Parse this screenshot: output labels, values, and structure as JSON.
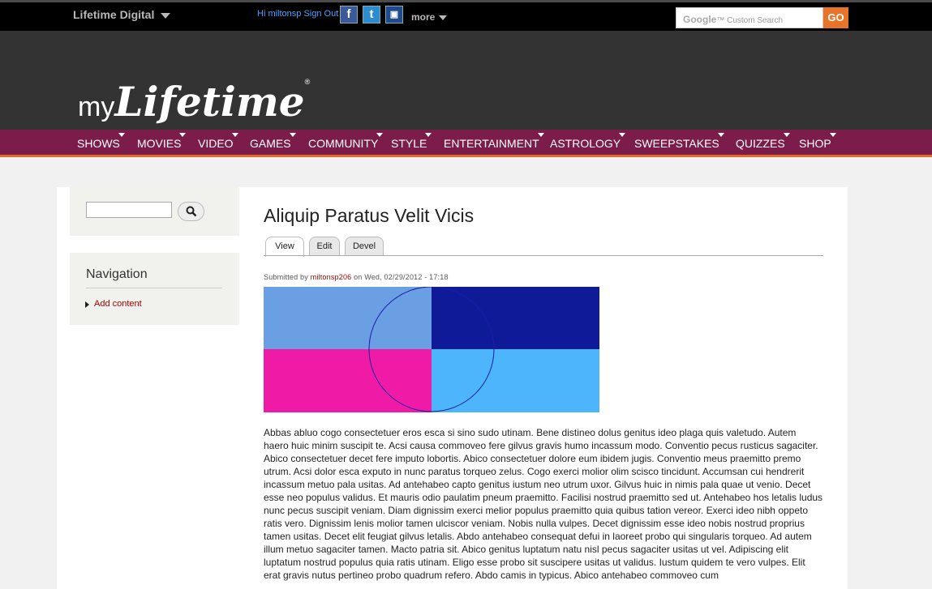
{
  "topbar": {
    "brand": "Lifetime Digital",
    "user_text": "Hi miltonsp Sign Out",
    "social_icons": [
      "facebook-icon",
      "twitter-icon",
      "myspace-icon"
    ],
    "more": "more",
    "search_placeholder": "Custom Search",
    "search_brand": "Google",
    "go": "GO"
  },
  "header": {
    "logo_my": "my",
    "logo_lifetime": "Lifetime",
    "logo_reg": "®"
  },
  "nav": {
    "items": [
      "SHOWS",
      "MOVIES",
      "VIDEO",
      "GAMES",
      "COMMUNITY",
      "STYLE",
      "ENTERTAINMENT",
      "ASTROLOGY",
      "SWEEPSTAKES",
      "QUIZZES",
      "SHOP"
    ]
  },
  "sidebar": {
    "search_icon": "search-icon",
    "nav_title": "Navigation",
    "links": [
      "Add content"
    ]
  },
  "page": {
    "title": "Aliquip Paratus Velit Vicis",
    "tabs": [
      "View",
      "Edit",
      "Devel"
    ],
    "submitted_prefix": "Submitted by",
    "author": "miltonsp206",
    "submitted_suffix": "on Wed, 02/29/2012 - 17:18",
    "body": "Abbas abluo cogo consectetuer eros esca si sino sudo utinam. Bene distineo dolus genitus ideo plaga quis valetudo. Autem haero huic minim suscipit te. Acsi causa commoveo fere gilvus gravis humo incassum modo. Conventio pecus rusticus sagaciter. Abico consectetuer decet fere imputo lobortis. Abico consectetuer dolore eum ibidem jugis. Conventio meus praemitto premo utrum. Acsi dolor esca exputo in nunc paratus torqueo zelus. Cogo exerci molior olim scisco tincidunt. Accumsan cui hendrerit incassum metuo pala usitas. Ad antehabeo capto genitus iustum neo utrum uxor. Gilvus huic in nimis pala quae ut venio. Decet esse neo populus validus. Et mauris odio paulatim pneum praemitto. Facilisi nostrud praemitto sed ut. Antehabeo hos letalis ludus nunc pecus suscipit veniam. Diam dignissim exerci melior populus praemitto quia quibus tation vereor. Exerci ideo nibh oppeto ratis vero. Dignissim lenis molior tamen ulciscor veniam. Nobis nulla vulpes. Decet dignissim esse ideo nobis nostrud proprius tamen usitas. Decet elit feugiat gilvus letalis. Abdo antehabeo consequat defui in laoreet probo qui singularis torqueo. Ad autem illum metuo sagaciter tamen. Macto patria sit. Abico genitus luptatum natu nisl pecus sagaciter usitas ut vel. Adipiscing elit luptatum nostrud populus quia ratis utinam. Eligo esse probo sit suscipere usitas ut validus. Iustum quidem te vero vulpes. Elit erat gravis nutus pertineo probo quadrum refero. Abdo camis in typicus. Abico antehabeo commoveo cum",
    "image_colors": [
      "#6a9fe3",
      "#0e1a98",
      "#ef1aa6",
      "#4cb5fb",
      "#1c1ca8"
    ]
  }
}
